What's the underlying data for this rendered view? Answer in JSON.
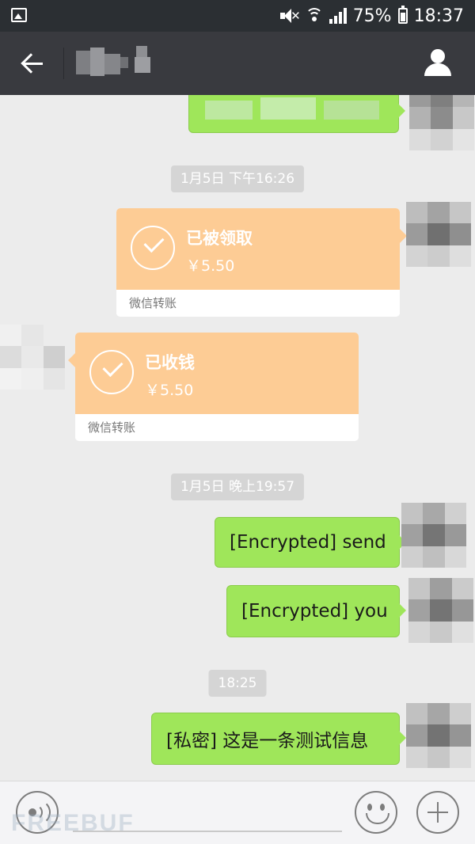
{
  "status_bar": {
    "battery": "75%",
    "time": "18:37"
  },
  "chat": {
    "partial_message": "",
    "timestamps": [
      "1月5日 下午16:26",
      "1月5日 晚上19:57",
      "18:25"
    ],
    "transfers": [
      {
        "title": "已被领取",
        "amount": "￥5.50",
        "footer": "微信转账"
      },
      {
        "title": "已收钱",
        "amount": "￥5.50",
        "footer": "微信转账"
      }
    ],
    "messages": [
      "[Encrypted] send",
      "[Encrypted] you",
      "[私密] 这是一条测试信息"
    ]
  },
  "watermark": "FREEBUF"
}
